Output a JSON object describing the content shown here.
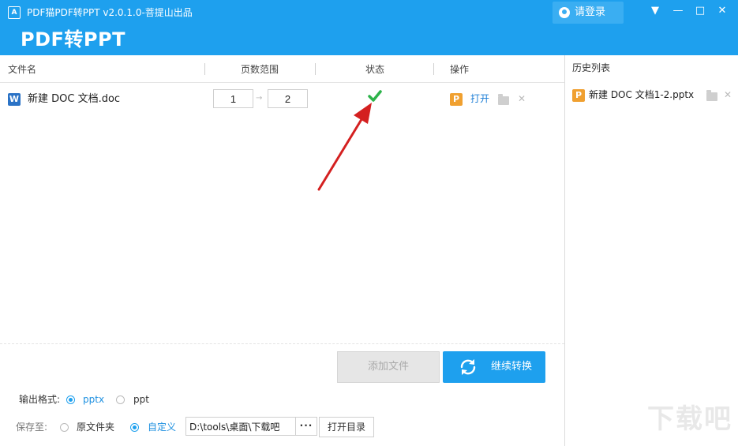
{
  "window": {
    "title": "PDF猫PDF转PPT v2.0.1.0-菩提山出品",
    "big_title": "PDF转PPT",
    "login_label": "请登录"
  },
  "table": {
    "headers": [
      "文件名",
      "页数范围",
      "状态",
      "操作"
    ],
    "rows": [
      {
        "file_name": "新建 DOC 文档.doc",
        "page_from": "1",
        "page_to": "2",
        "range_separator": "→",
        "status_icon": "check-icon",
        "action_open": "打开"
      }
    ]
  },
  "history": {
    "title": "历史列表",
    "items": [
      {
        "name": "新建 DOC 文档1-2.pptx"
      }
    ]
  },
  "buttons": {
    "add_file": "添加文件",
    "convert": "继续转换"
  },
  "output": {
    "label": "输出格式:",
    "options": [
      "pptx",
      "ppt"
    ],
    "selected": "pptx"
  },
  "save": {
    "label": "保存至:",
    "options": [
      "原文件夹",
      "自定义"
    ],
    "selected": "自定义",
    "path": "D:\\tools\\桌面\\下载吧",
    "browse": "···",
    "open_dir": "打开目录"
  },
  "watermark": "下载吧",
  "colors": {
    "accent": "#1ea0ee",
    "success": "#2db34a",
    "arrow": "#d42020",
    "ppt_icon": "#f0a030",
    "word_icon": "#2b73c6"
  }
}
